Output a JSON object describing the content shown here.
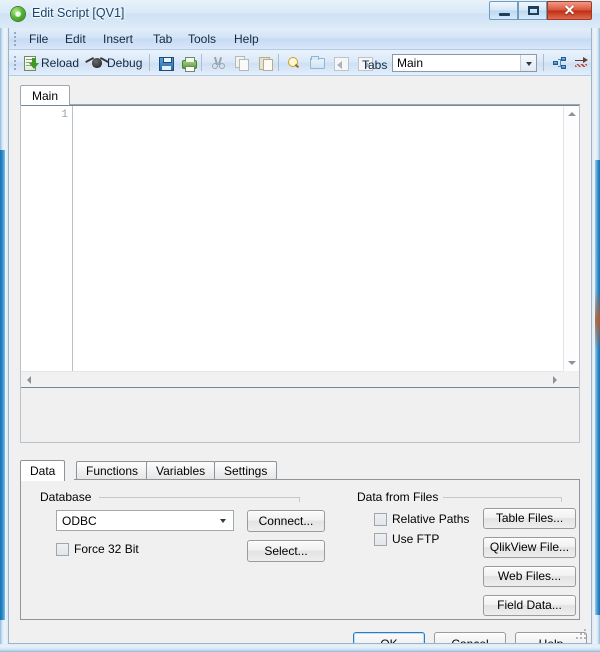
{
  "window": {
    "title": "Edit Script [QV1]",
    "app_icon": "qlikview-green-orb-icon",
    "controls": {
      "minimize": "minimize-icon",
      "maximize": "maximize-icon",
      "close": "✕"
    }
  },
  "menubar": {
    "items": [
      {
        "label": "File"
      },
      {
        "label": "Edit"
      },
      {
        "label": "Insert"
      },
      {
        "label": "Tab"
      },
      {
        "label": "Tools"
      },
      {
        "label": "Help"
      }
    ]
  },
  "toolbar": {
    "reload_label": "Reload",
    "debug_label": "Debug",
    "tabs_label": "Tabs",
    "tabs_combo_value": "Main",
    "icons": {
      "reload": "reload-icon",
      "debug": "debug-bug-icon",
      "save": "save-floppy-icon",
      "print": "print-icon",
      "cut": "cut-scissors-icon",
      "copy": "copy-icon",
      "paste": "paste-icon",
      "search": "search-magnifier-icon",
      "folder": "open-folder-icon",
      "move_left": "move-tab-left-icon",
      "move_right": "move-tab-right-icon",
      "promote": "promote-tab-icon",
      "goto": "goto-tab-icon"
    }
  },
  "editor": {
    "tab_label": "Main",
    "line_numbers": [
      "1"
    ],
    "content": ""
  },
  "bottom_tabs": {
    "items": [
      {
        "label": "Data",
        "active": true
      },
      {
        "label": "Functions",
        "active": false
      },
      {
        "label": "Variables",
        "active": false
      },
      {
        "label": "Settings",
        "active": false
      }
    ]
  },
  "data_tab": {
    "database_group": {
      "title": "Database",
      "combo_value": "ODBC",
      "force32_label": "Force 32 Bit",
      "force32_checked": false,
      "connect_label": "Connect...",
      "select_label": "Select..."
    },
    "files_group": {
      "title": "Data from Files",
      "relative_paths_label": "Relative Paths",
      "relative_paths_checked": false,
      "use_ftp_label": "Use FTP",
      "use_ftp_checked": false,
      "table_files_label": "Table Files...",
      "qlikview_file_label": "QlikView File...",
      "web_files_label": "Web Files...",
      "field_data_label": "Field Data..."
    }
  },
  "dialog_buttons": {
    "ok_label": "OK",
    "cancel_label": "Cancel",
    "help_label": "Help"
  },
  "colors": {
    "accent_blue": "#2f7bbd",
    "title_text": "#16456d",
    "close_red": "#bf2d14",
    "panel_bg": "#f0f0f0"
  }
}
